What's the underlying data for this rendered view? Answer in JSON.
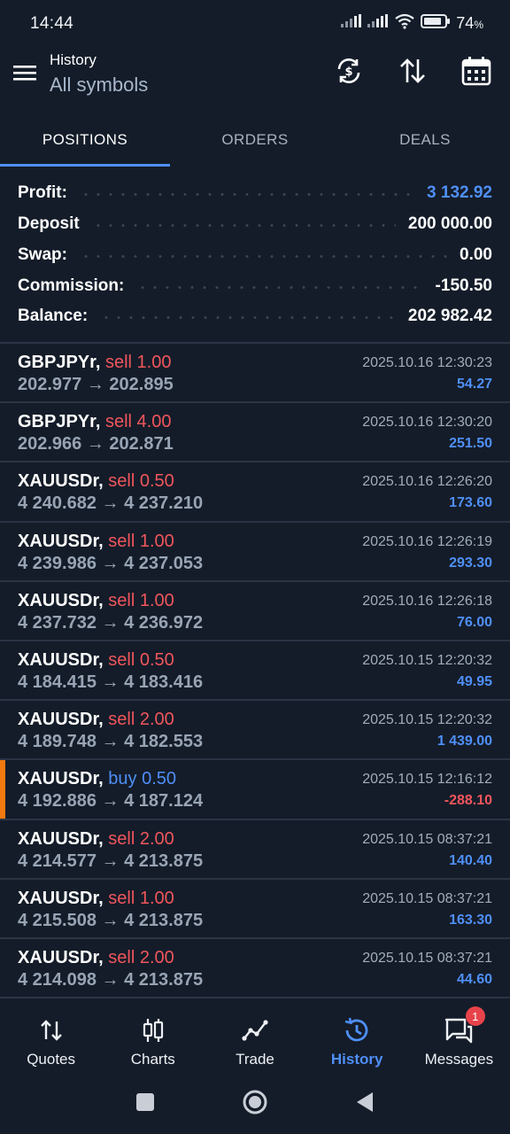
{
  "status": {
    "time": "14:44",
    "battery": "74",
    "battery_unit": "%"
  },
  "appbar": {
    "title": "History",
    "subtitle": "All symbols"
  },
  "tabs": [
    {
      "label": "POSITIONS",
      "active": true
    },
    {
      "label": "ORDERS",
      "active": false
    },
    {
      "label": "DEALS",
      "active": false
    }
  ],
  "summary": {
    "profit_label": "Profit:",
    "profit_value": "3 132.92",
    "deposit_label": "Deposit",
    "deposit_value": "200 000.00",
    "swap_label": "Swap:",
    "swap_value": "0.00",
    "commission_label": "Commission:",
    "commission_value": "-150.50",
    "balance_label": "Balance:",
    "balance_value": "202 982.42"
  },
  "deals": [
    {
      "symbol": "GBPJPYr,",
      "side": "sell 1.00",
      "type": "sell",
      "prices": "202.977 → 202.895",
      "time": "2025.10.16 12:30:23",
      "profit": "54.27"
    },
    {
      "symbol": "GBPJPYr,",
      "side": "sell 4.00",
      "type": "sell",
      "prices": "202.966 → 202.871",
      "time": "2025.10.16 12:30:20",
      "profit": "251.50"
    },
    {
      "symbol": "XAUUSDr,",
      "side": "sell 0.50",
      "type": "sell",
      "prices": "4 240.682 → 4 237.210",
      "time": "2025.10.16 12:26:20",
      "profit": "173.60"
    },
    {
      "symbol": "XAUUSDr,",
      "side": "sell 1.00",
      "type": "sell",
      "prices": "4 239.986 → 4 237.053",
      "time": "2025.10.16 12:26:19",
      "profit": "293.30"
    },
    {
      "symbol": "XAUUSDr,",
      "side": "sell 1.00",
      "type": "sell",
      "prices": "4 237.732 → 4 236.972",
      "time": "2025.10.16 12:26:18",
      "profit": "76.00"
    },
    {
      "symbol": "XAUUSDr,",
      "side": "sell 0.50",
      "type": "sell",
      "prices": "4 184.415 → 4 183.416",
      "time": "2025.10.15 12:20:32",
      "profit": "49.95"
    },
    {
      "symbol": "XAUUSDr,",
      "side": "sell 2.00",
      "type": "sell",
      "prices": "4 189.748 → 4 182.553",
      "time": "2025.10.15 12:20:32",
      "profit": "1 439.00"
    },
    {
      "symbol": "XAUUSDr,",
      "side": "buy 0.50",
      "type": "buy",
      "prices": "4 192.886 → 4 187.124",
      "time": "2025.10.15 12:16:12",
      "profit": "-288.10"
    },
    {
      "symbol": "XAUUSDr,",
      "side": "sell 2.00",
      "type": "sell",
      "prices": "4 214.577 → 4 213.875",
      "time": "2025.10.15 08:37:21",
      "profit": "140.40"
    },
    {
      "symbol": "XAUUSDr,",
      "side": "sell 1.00",
      "type": "sell",
      "prices": "4 215.508 → 4 213.875",
      "time": "2025.10.15 08:37:21",
      "profit": "163.30"
    },
    {
      "symbol": "XAUUSDr,",
      "side": "sell 2.00",
      "type": "sell",
      "prices": "4 214.098 → 4 213.875",
      "time": "2025.10.15 08:37:21",
      "profit": "44.60"
    }
  ],
  "bottom_nav": [
    {
      "label": "Quotes",
      "icon": "quotes-icon"
    },
    {
      "label": "Charts",
      "icon": "charts-icon"
    },
    {
      "label": "Trade",
      "icon": "trade-icon"
    },
    {
      "label": "History",
      "icon": "history-icon",
      "active": true
    },
    {
      "label": "Messages",
      "icon": "messages-icon",
      "badge": "1"
    }
  ],
  "colors": {
    "background": "#141c29",
    "accent": "#4f8ff7",
    "sell": "#f0565c",
    "highlight": "#f2790f"
  }
}
